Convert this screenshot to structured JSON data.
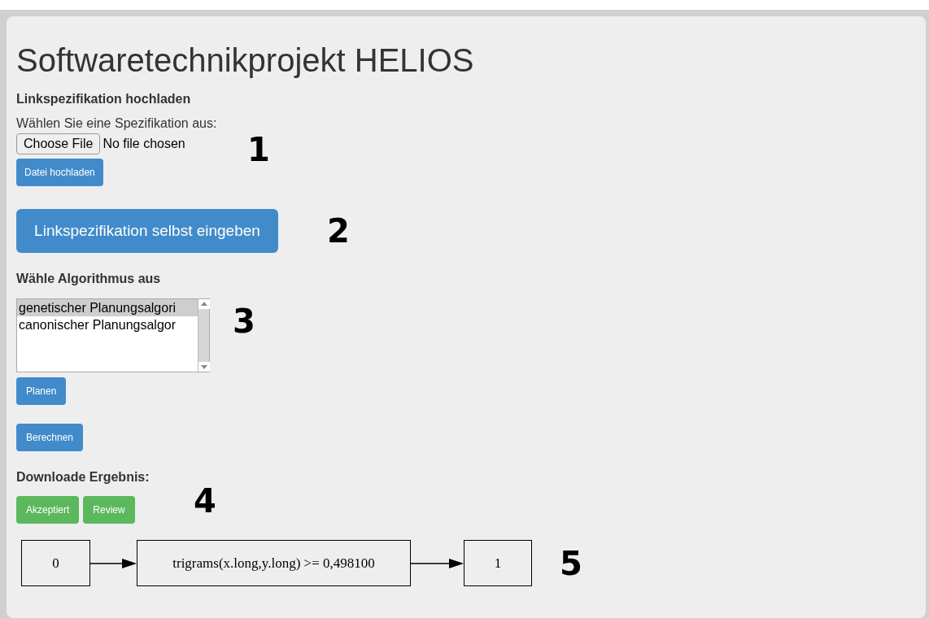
{
  "title": "Softwaretechnikprojekt HELIOS",
  "upload": {
    "heading": "Linkspezifikation hochladen",
    "prompt": "Wählen Sie eine Spezifikation aus:",
    "file_button": "Choose File",
    "file_status": "No file chosen",
    "submit": "Datei hochladen",
    "marker": "1"
  },
  "manual": {
    "button": "Linkspezifikation selbst eingeben",
    "marker": "2"
  },
  "algorithm": {
    "heading": "Wähle Algorithmus aus",
    "options": [
      {
        "label": "genetischer Planungsalgori",
        "selected": true
      },
      {
        "label": "canonischer Planungsalgor",
        "selected": false
      }
    ],
    "marker": "3",
    "plan_button": "Planen",
    "compute_button": "Berechnen"
  },
  "download": {
    "heading": "Downloade Ergebnis:",
    "buttons": [
      "Akzeptiert",
      "Review"
    ],
    "marker": "4"
  },
  "graph": {
    "nodes": [
      "0",
      "trigrams(x.long,y.long) >= 0,498100",
      "1"
    ],
    "marker": "5"
  }
}
